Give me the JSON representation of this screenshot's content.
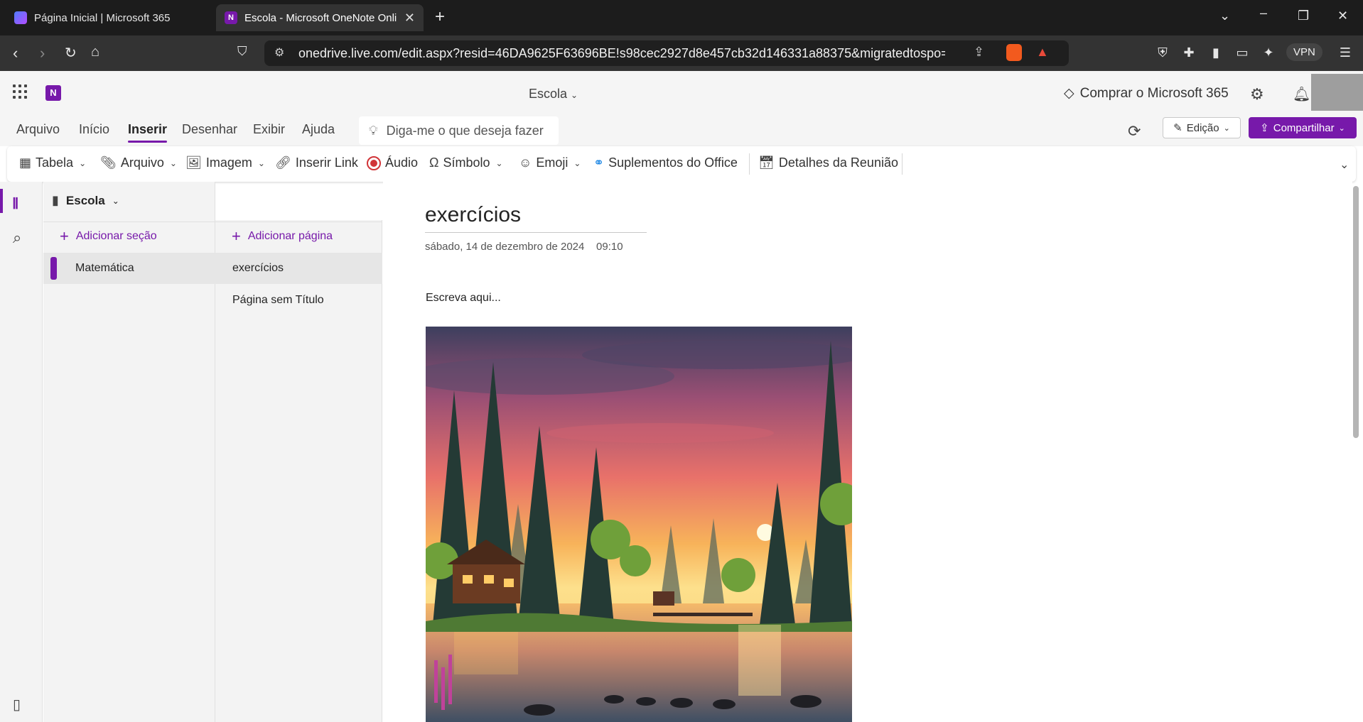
{
  "browser": {
    "tabs": [
      {
        "title": "Página Inicial | Microsoft 365",
        "active": false
      },
      {
        "title": "Escola - Microsoft OneNote Online",
        "active": true
      }
    ],
    "url": "onedrive.live.com/edit.aspx?resid=46DA9625F63696BE!s98cec2927d8e457cb32d146331a88375&migratedtospo=true&...",
    "vpn_label": "VPN"
  },
  "app": {
    "notebook_title": "Escola",
    "buy_label": "Comprar o Microsoft 365",
    "accent": "#7719aa"
  },
  "ribbon_tabs": [
    "Arquivo",
    "Início",
    "Inserir",
    "Desenhar",
    "Exibir",
    "Ajuda"
  ],
  "active_ribbon_tab": "Inserir",
  "tellme_placeholder": "Diga-me o que deseja fazer",
  "edit_label": "Edição",
  "share_label": "Compartilhar",
  "commands": {
    "table": "Tabela",
    "file": "Arquivo",
    "image": "Imagem",
    "link": "Inserir Link",
    "audio": "Áudio",
    "symbol": "Símbolo",
    "emoji": "Emoji",
    "addins": "Suplementos do Office",
    "meeting": "Detalhes da Reunião"
  },
  "navigation": {
    "notebook": "Escola",
    "add_section": "Adicionar seção",
    "add_page": "Adicionar página",
    "sections": [
      {
        "label": "Matemática",
        "color": "#7719aa"
      }
    ],
    "pages": [
      {
        "label": "exercícios",
        "selected": true
      },
      {
        "label": "Página sem Título",
        "selected": false
      }
    ]
  },
  "page": {
    "title": "exercícios",
    "date": "sábado, 14 de dezembro de 2024",
    "time": "09:10",
    "body": "Escreva aqui..."
  }
}
